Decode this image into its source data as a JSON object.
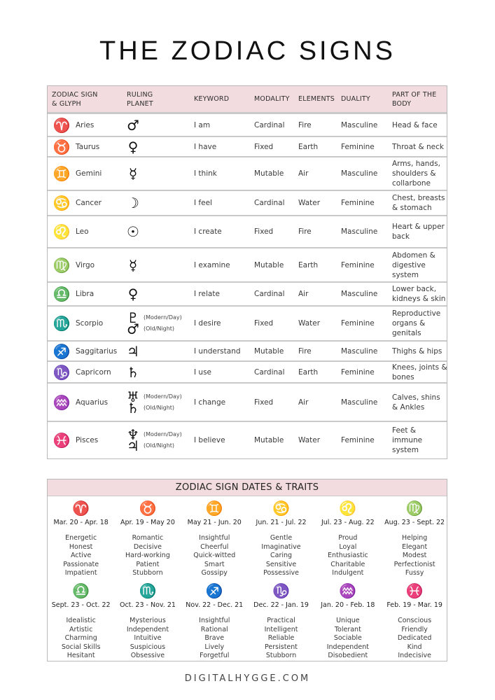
{
  "title": "THE ZODIAC SIGNS",
  "table": {
    "headers": {
      "sign": [
        "ZODIAC SIGN",
        "& GLYPH"
      ],
      "planet": [
        "RULING",
        "PLANET"
      ],
      "keyword": "KEYWORD",
      "modality": "MODALITY",
      "elements": "ELEMENTS",
      "duality": "DUALITY",
      "body": [
        "PART OF THE",
        "BODY"
      ]
    },
    "rows": [
      {
        "glyph": "♈",
        "name": "Aries",
        "planets": [
          {
            "glyph": "♂",
            "note": ""
          }
        ],
        "keyword": "I am",
        "modality": "Cardinal",
        "element": "Fire",
        "duality": "Masculine",
        "body": "Head & face"
      },
      {
        "glyph": "♉",
        "name": "Taurus",
        "planets": [
          {
            "glyph": "♀",
            "note": ""
          }
        ],
        "keyword": "I have",
        "modality": "Fixed",
        "element": "Earth",
        "duality": "Feminine",
        "body": "Throat & neck"
      },
      {
        "glyph": "♊",
        "name": "Gemini",
        "planets": [
          {
            "glyph": "☿",
            "note": ""
          }
        ],
        "keyword": "I think",
        "modality": "Mutable",
        "element": "Air",
        "duality": "Masculine",
        "body": "Arms, hands, shoulders & collarbone"
      },
      {
        "glyph": "♋",
        "name": "Cancer",
        "planets": [
          {
            "glyph": "☽",
            "note": ""
          }
        ],
        "keyword": "I feel",
        "modality": "Cardinal",
        "element": "Water",
        "duality": "Feminine",
        "body": "Chest, breasts & stomach"
      },
      {
        "glyph": "♌",
        "name": "Leo",
        "planets": [
          {
            "glyph": "☉",
            "note": ""
          }
        ],
        "keyword": "I create",
        "modality": "Fixed",
        "element": "Fire",
        "duality": "Masculine",
        "body": "Heart & upper back"
      },
      {
        "glyph": "♍",
        "name": "Virgo",
        "planets": [
          {
            "glyph": "☿",
            "note": ""
          }
        ],
        "keyword": "I examine",
        "modality": "Mutable",
        "element": "Earth",
        "duality": "Feminine",
        "body": "Abdomen & digestive system"
      },
      {
        "glyph": "♎",
        "name": "Libra",
        "planets": [
          {
            "glyph": "♀",
            "note": ""
          }
        ],
        "keyword": "I relate",
        "modality": "Cardinal",
        "element": "Air",
        "duality": "Masculine",
        "body": "Lower back, kidneys & skin"
      },
      {
        "glyph": "♏",
        "name": "Scorpio",
        "planets": [
          {
            "glyph": "♇",
            "note": "(Modern/Day)"
          },
          {
            "glyph": "♂",
            "note": "(Old/Night)"
          }
        ],
        "keyword": "I desire",
        "modality": "Fixed",
        "element": "Water",
        "duality": "Feminine",
        "body": "Reproductive organs & genitals"
      },
      {
        "glyph": "♐",
        "name": "Saggitarius",
        "planets": [
          {
            "glyph": "♃",
            "note": ""
          }
        ],
        "keyword": "I understand",
        "modality": "Mutable",
        "element": "Fire",
        "duality": "Masculine",
        "body": "Thighs & hips"
      },
      {
        "glyph": "♑",
        "name": "Capricorn",
        "planets": [
          {
            "glyph": "♄",
            "note": ""
          }
        ],
        "keyword": "I use",
        "modality": "Cardinal",
        "element": "Earth",
        "duality": "Feminine",
        "body": "Knees, joints & bones"
      },
      {
        "glyph": "♒",
        "name": "Aquarius",
        "planets": [
          {
            "glyph": "♅",
            "note": "(Modern/Day)"
          },
          {
            "glyph": "♄",
            "note": "(Old/Night)"
          }
        ],
        "keyword": "I change",
        "modality": "Fixed",
        "element": "Air",
        "duality": "Masculine",
        "body": "Calves, shins & Ankles"
      },
      {
        "glyph": "♓",
        "name": "Pisces",
        "planets": [
          {
            "glyph": "♆",
            "note": "(Modern/Day)"
          },
          {
            "glyph": "♃",
            "note": "(Old/Night)"
          }
        ],
        "keyword": "I believe",
        "modality": "Mutable",
        "element": "Water",
        "duality": "Feminine",
        "body": "Feet & immune system"
      }
    ]
  },
  "traits": {
    "title": "ZODIAC SIGN DATES & TRAITS",
    "signs": [
      {
        "glyph": "♈",
        "dates": "Mar. 20 - Apr. 18",
        "traits": [
          "Energetic",
          "Honest",
          "Active",
          "Passionate",
          "Impatient"
        ]
      },
      {
        "glyph": "♉",
        "dates": "Apr. 19 - May 20",
        "traits": [
          "Romantic",
          "Decisive",
          "Hard-working",
          "Patient",
          "Stubborn"
        ]
      },
      {
        "glyph": "♊",
        "dates": "May 21 - Jun. 20",
        "traits": [
          "Insightful",
          "Cheerful",
          "Quick-witted",
          "Smart",
          "Gossipy"
        ]
      },
      {
        "glyph": "♋",
        "dates": "Jun. 21 - Jul. 22",
        "traits": [
          "Gentle",
          "Imaginative",
          "Caring",
          "Sensitive",
          "Possessive"
        ]
      },
      {
        "glyph": "♌",
        "dates": "Jul. 23 - Aug. 22",
        "traits": [
          "Proud",
          "Loyal",
          "Enthusiastic",
          "Charitable",
          "Indulgent"
        ]
      },
      {
        "glyph": "♍",
        "dates": "Aug. 23 - Sept. 22",
        "traits": [
          "Helping",
          "Elegant",
          "Modest",
          "Perfectionist",
          "Fussy"
        ]
      },
      {
        "glyph": "♎",
        "dates": "Sept. 23 - Oct. 22",
        "traits": [
          "Idealistic",
          "Artistic",
          "Charming",
          "Social Skills",
          "Hesitant"
        ]
      },
      {
        "glyph": "♏",
        "dates": "Oct. 23 - Nov. 21",
        "traits": [
          "Mysterious",
          "Independent",
          "Intuitive",
          "Suspicious",
          "Obsessive"
        ]
      },
      {
        "glyph": "♐",
        "dates": "Nov. 22 - Dec. 21",
        "traits": [
          "Insightful",
          "Rational",
          "Brave",
          "Lively",
          "Forgetful"
        ]
      },
      {
        "glyph": "♑",
        "dates": "Dec. 22 - Jan. 19",
        "traits": [
          "Practical",
          "Intelligent",
          "Reliable",
          "Persistent",
          "Stubborn"
        ]
      },
      {
        "glyph": "♒",
        "dates": "Jan. 20 - Feb. 18",
        "traits": [
          "Unique",
          "Tolerant",
          "Sociable",
          "Independent",
          "Disobedient"
        ]
      },
      {
        "glyph": "♓",
        "dates": "Feb. 19 - Mar. 19",
        "traits": [
          "Conscious",
          "Friendly",
          "Dedicated",
          "Kind",
          "Indecisive"
        ]
      }
    ]
  },
  "footer": "DIGITALHYGGE.COM",
  "colors": {
    "header_bg": "#f2dcdf",
    "border": "#c9c9c9",
    "text": "#2b2b2b"
  }
}
